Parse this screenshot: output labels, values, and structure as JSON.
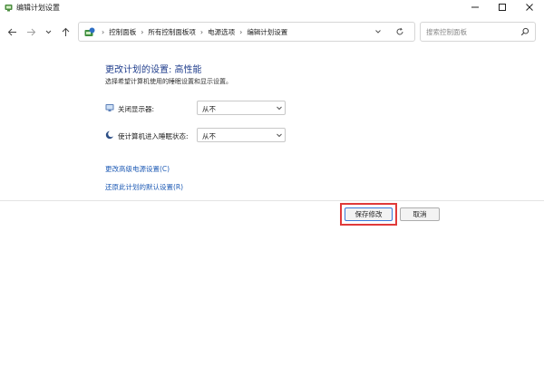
{
  "window": {
    "title": "编辑计划设置"
  },
  "address": {
    "crumbs": [
      "控制面板",
      "所有控制面板项",
      "电源选项",
      "编辑计划设置"
    ]
  },
  "search": {
    "placeholder": "搜索控制面板"
  },
  "main": {
    "title": "更改计划的设置: 高性能",
    "description": "选择希望计算机使用的睡眠设置和显示设置。",
    "settings": [
      {
        "label": "关闭显示器:",
        "value": "从不",
        "icon": "monitor-icon"
      },
      {
        "label": "使计算机进入睡眠状态:",
        "value": "从不",
        "icon": "sleep-moon-icon"
      }
    ],
    "links": {
      "advanced": "更改高级电源设置(C)",
      "restore": "还原此计划的默认设置(R)"
    }
  },
  "footer": {
    "save_label": "保存修改",
    "cancel_label": "取消"
  },
  "colors": {
    "title": "#1f3d8c",
    "link": "#1f5bb5",
    "highlight": "#e03a3a"
  }
}
